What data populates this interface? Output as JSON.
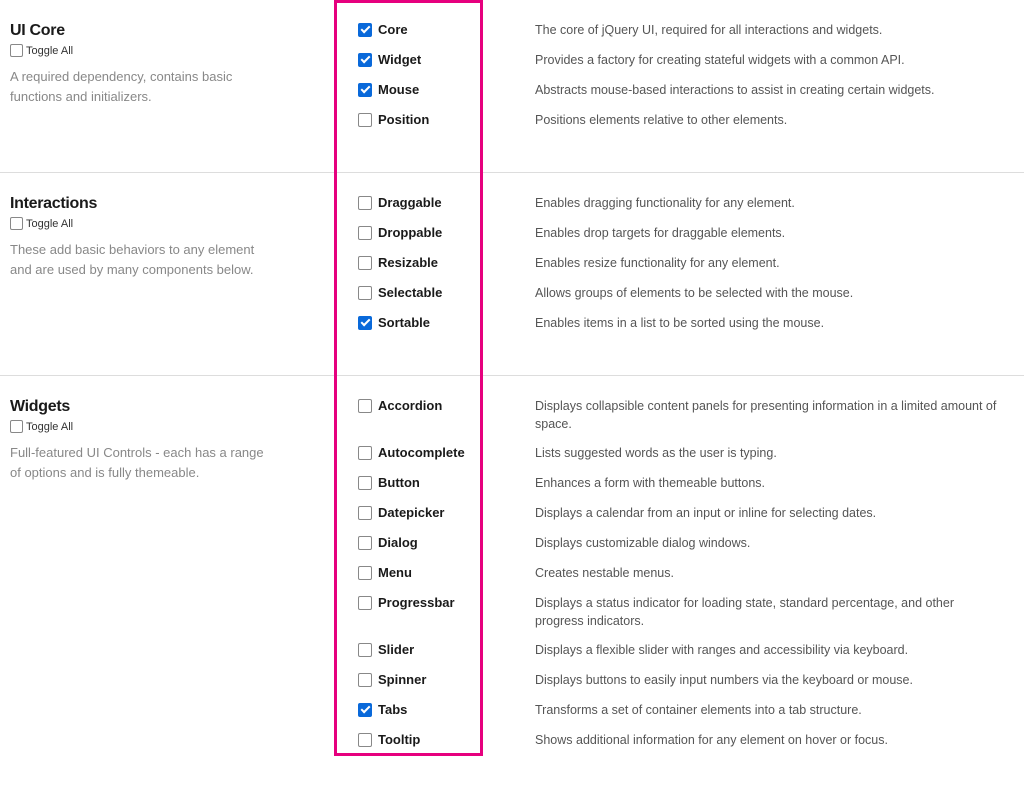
{
  "sections": [
    {
      "title": "UI Core",
      "toggle_label": "Toggle All",
      "desc": "A required dependency, contains basic functions and initializers.",
      "items": [
        {
          "label": "Core",
          "checked": true,
          "desc": "The core of jQuery UI, required for all interactions and widgets."
        },
        {
          "label": "Widget",
          "checked": true,
          "desc": "Provides a factory for creating stateful widgets with a common API."
        },
        {
          "label": "Mouse",
          "checked": true,
          "desc": "Abstracts mouse-based interactions to assist in creating certain widgets."
        },
        {
          "label": "Position",
          "checked": false,
          "desc": "Positions elements relative to other elements."
        }
      ]
    },
    {
      "title": "Interactions",
      "toggle_label": "Toggle All",
      "desc": "These add basic behaviors to any element and are used by many components below.",
      "items": [
        {
          "label": "Draggable",
          "checked": false,
          "desc": "Enables dragging functionality for any element."
        },
        {
          "label": "Droppable",
          "checked": false,
          "desc": "Enables drop targets for draggable elements."
        },
        {
          "label": "Resizable",
          "checked": false,
          "desc": "Enables resize functionality for any element."
        },
        {
          "label": "Selectable",
          "checked": false,
          "desc": "Allows groups of elements to be selected with the mouse."
        },
        {
          "label": "Sortable",
          "checked": true,
          "desc": "Enables items in a list to be sorted using the mouse."
        }
      ]
    },
    {
      "title": "Widgets",
      "toggle_label": "Toggle All",
      "desc": "Full-featured UI Controls - each has a range of options and is fully themeable.",
      "items": [
        {
          "label": "Accordion",
          "checked": false,
          "desc": "Displays collapsible content panels for presenting information in a limited amount of space."
        },
        {
          "label": "Autocomplete",
          "checked": false,
          "desc": "Lists suggested words as the user is typing."
        },
        {
          "label": "Button",
          "checked": false,
          "desc": "Enhances a form with themeable buttons."
        },
        {
          "label": "Datepicker",
          "checked": false,
          "desc": "Displays a calendar from an input or inline for selecting dates."
        },
        {
          "label": "Dialog",
          "checked": false,
          "desc": "Displays customizable dialog windows."
        },
        {
          "label": "Menu",
          "checked": false,
          "desc": "Creates nestable menus."
        },
        {
          "label": "Progressbar",
          "checked": false,
          "desc": "Displays a status indicator for loading state, standard percentage, and other progress indicators."
        },
        {
          "label": "Slider",
          "checked": false,
          "desc": "Displays a flexible slider with ranges and accessibility via keyboard."
        },
        {
          "label": "Spinner",
          "checked": false,
          "desc": "Displays buttons to easily input numbers via the keyboard or mouse."
        },
        {
          "label": "Tabs",
          "checked": true,
          "desc": "Transforms a set of container elements into a tab structure."
        },
        {
          "label": "Tooltip",
          "checked": false,
          "desc": "Shows additional information for any element on hover or focus."
        }
      ]
    }
  ],
  "highlight_color": "#e6007e"
}
